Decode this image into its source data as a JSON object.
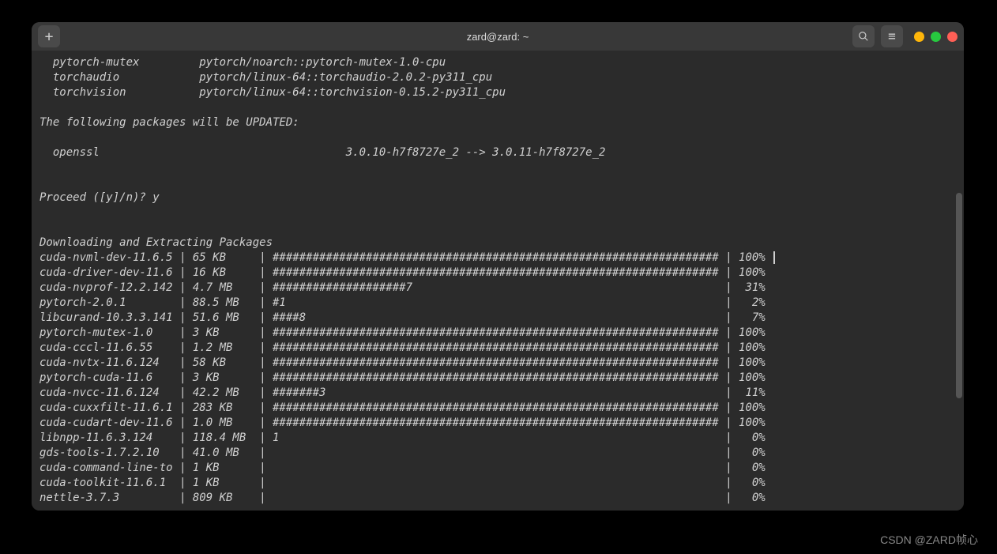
{
  "window": {
    "title": "zard@zard: ~"
  },
  "watermark": "CSDN @ZARD帧心",
  "preamble": {
    "packages": [
      {
        "name": "pytorch-mutex",
        "spec": "pytorch/noarch::pytorch-mutex-1.0-cpu"
      },
      {
        "name": "torchaudio",
        "spec": "pytorch/linux-64::torchaudio-2.0.2-py311_cpu"
      },
      {
        "name": "torchvision",
        "spec": "pytorch/linux-64::torchvision-0.15.2-py311_cpu"
      }
    ],
    "updated_header": "The following packages will be UPDATED:",
    "updated": [
      {
        "name": "openssl",
        "from": "3.0.10-h7f8727e_2",
        "to": "3.0.11-h7f8727e_2"
      }
    ],
    "prompt": "Proceed ([y]/n)? y",
    "download_header": "Downloading and Extracting Packages"
  },
  "downloads": [
    {
      "name": "cuda-nvml-dev-11.6.5",
      "size": "65 KB",
      "bar": "###################################################################",
      "pct": "100%"
    },
    {
      "name": "cuda-driver-dev-11.6",
      "size": "16 KB",
      "bar": "###################################################################",
      "pct": "100%"
    },
    {
      "name": "cuda-nvprof-12.2.142",
      "size": "4.7 MB",
      "bar": "####################7",
      "pct": "31%"
    },
    {
      "name": "pytorch-2.0.1",
      "size": "88.5 MB",
      "bar": "#1",
      "pct": "2%"
    },
    {
      "name": "libcurand-10.3.3.141",
      "size": "51.6 MB",
      "bar": "####8",
      "pct": "7%"
    },
    {
      "name": "pytorch-mutex-1.0",
      "size": "3 KB",
      "bar": "###################################################################",
      "pct": "100%"
    },
    {
      "name": "cuda-cccl-11.6.55",
      "size": "1.2 MB",
      "bar": "###################################################################",
      "pct": "100%"
    },
    {
      "name": "cuda-nvtx-11.6.124",
      "size": "58 KB",
      "bar": "###################################################################",
      "pct": "100%"
    },
    {
      "name": "pytorch-cuda-11.6",
      "size": "3 KB",
      "bar": "###################################################################",
      "pct": "100%"
    },
    {
      "name": "cuda-nvcc-11.6.124",
      "size": "42.2 MB",
      "bar": "#######3",
      "pct": "11%"
    },
    {
      "name": "cuda-cuxxfilt-11.6.1",
      "size": "283 KB",
      "bar": "###################################################################",
      "pct": "100%"
    },
    {
      "name": "cuda-cudart-dev-11.6",
      "size": "1.0 MB",
      "bar": "###################################################################",
      "pct": "100%"
    },
    {
      "name": "libnpp-11.6.3.124",
      "size": "118.4 MB",
      "bar": "1",
      "pct": "0%"
    },
    {
      "name": "gds-tools-1.7.2.10",
      "size": "41.0 MB",
      "bar": "",
      "pct": "0%"
    },
    {
      "name": "cuda-command-line-to",
      "size": "1 KB",
      "bar": "",
      "pct": "0%"
    },
    {
      "name": "cuda-toolkit-11.6.1",
      "size": "1 KB",
      "bar": "",
      "pct": "0%"
    },
    {
      "name": "nettle-3.7.3",
      "size": "809 KB",
      "bar": "",
      "pct": "0%"
    }
  ]
}
